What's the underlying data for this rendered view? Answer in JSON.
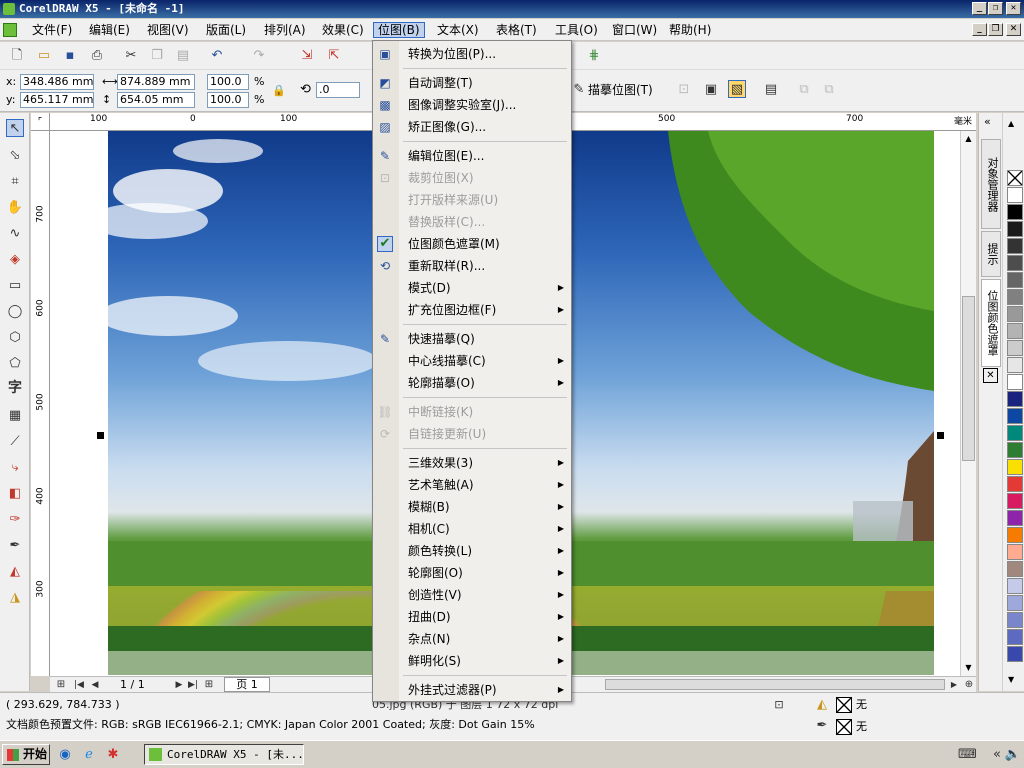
{
  "window": {
    "title": "CorelDRAW X5 - [未命名 -1]"
  },
  "menubar": [
    "文件(F)",
    "编辑(E)",
    "视图(V)",
    "版面(L)",
    "排列(A)",
    "效果(C)",
    "位图(B)",
    "文本(X)",
    "表格(T)",
    "工具(O)",
    "窗口(W)",
    "帮助(H)"
  ],
  "property_bar": {
    "x": "348.486 mm",
    "y": "465.117 mm",
    "width": "874.889 mm",
    "height": "654.05 mm",
    "scale_x": "100.0",
    "scale_y": "100.0",
    "pct": "%",
    "rotation": ".0",
    "trace_label": "描摹位图(T)"
  },
  "ruler_top": [
    "100",
    "0",
    "100",
    "500",
    "700",
    "毫米"
  ],
  "ruler_left": [
    "700",
    "600",
    "500",
    "400",
    "300"
  ],
  "bitmap_menu": [
    {
      "label": "转换为位图(P)...",
      "icon": "convert-bitmap-icon",
      "disabled": false,
      "submenu": false
    },
    {
      "sep": true
    },
    {
      "label": "自动调整(T)",
      "icon": "auto-adjust-icon",
      "disabled": false,
      "submenu": false
    },
    {
      "label": "图像调整实验室(J)...",
      "icon": "image-lab-icon",
      "disabled": false,
      "submenu": false
    },
    {
      "label": "矫正图像(G)...",
      "icon": "straighten-icon",
      "disabled": false,
      "submenu": false
    },
    {
      "sep": true
    },
    {
      "label": "编辑位图(E)...",
      "icon": "edit-bitmap-icon",
      "disabled": false,
      "submenu": false
    },
    {
      "label": "裁剪位图(X)",
      "icon": "crop-bitmap-icon",
      "disabled": true,
      "submenu": false
    },
    {
      "label": "打开版样来源(U)",
      "icon": "",
      "disabled": true,
      "submenu": false
    },
    {
      "label": "替换版样(C)...",
      "icon": "",
      "disabled": true,
      "submenu": false
    },
    {
      "label": "位图颜色遮罩(M)",
      "icon": "check-icon",
      "disabled": false,
      "submenu": false,
      "checked": true
    },
    {
      "label": "重新取样(R)...",
      "icon": "resample-icon",
      "disabled": false,
      "submenu": false
    },
    {
      "label": "模式(D)",
      "icon": "",
      "disabled": false,
      "submenu": true
    },
    {
      "label": "扩充位图边框(F)",
      "icon": "",
      "disabled": false,
      "submenu": true
    },
    {
      "sep": true
    },
    {
      "label": "快速描摹(Q)",
      "icon": "quick-trace-icon",
      "disabled": false,
      "submenu": false
    },
    {
      "label": "中心线描摹(C)",
      "icon": "",
      "disabled": false,
      "submenu": true
    },
    {
      "label": "轮廓描摹(O)",
      "icon": "",
      "disabled": false,
      "submenu": true
    },
    {
      "sep": true
    },
    {
      "label": "中断链接(K)",
      "icon": "break-link-icon",
      "disabled": true,
      "submenu": false
    },
    {
      "label": "自链接更新(U)",
      "icon": "update-link-icon",
      "disabled": true,
      "submenu": false
    },
    {
      "sep": true
    },
    {
      "label": "三维效果(3)",
      "icon": "",
      "disabled": false,
      "submenu": true
    },
    {
      "label": "艺术笔触(A)",
      "icon": "",
      "disabled": false,
      "submenu": true
    },
    {
      "label": "模糊(B)",
      "icon": "",
      "disabled": false,
      "submenu": true
    },
    {
      "label": "相机(C)",
      "icon": "",
      "disabled": false,
      "submenu": true
    },
    {
      "label": "颜色转换(L)",
      "icon": "",
      "disabled": false,
      "submenu": true
    },
    {
      "label": "轮廓图(O)",
      "icon": "",
      "disabled": false,
      "submenu": true
    },
    {
      "label": "创造性(V)",
      "icon": "",
      "disabled": false,
      "submenu": true
    },
    {
      "label": "扭曲(D)",
      "icon": "",
      "disabled": false,
      "submenu": true
    },
    {
      "label": "杂点(N)",
      "icon": "",
      "disabled": false,
      "submenu": true
    },
    {
      "label": "鲜明化(S)",
      "icon": "",
      "disabled": false,
      "submenu": true
    },
    {
      "sep": true
    },
    {
      "label": "外挂式过滤器(P)",
      "icon": "",
      "disabled": false,
      "submenu": true
    }
  ],
  "page_nav": {
    "count": "1 / 1",
    "tab": "页 1"
  },
  "docker_tabs": [
    "对象管理器",
    "提示",
    "位图颜色遮罩"
  ],
  "palette": [
    "#ffffff",
    "#000000",
    "#1a1a1a",
    "#333333",
    "#4d4d4d",
    "#666666",
    "#808080",
    "#999999",
    "#b3b3b3",
    "#cccccc",
    "#e6e6e6",
    "#ffffff",
    "#1a237e",
    "#0d47a1",
    "#00897b",
    "#2e7d32",
    "#f9e000",
    "#e53935",
    "#d81b60",
    "#8e24aa",
    "#f57c00",
    "#ffab91",
    "#a1887f",
    "#c5cae9",
    "#9fa8da",
    "#7986cb",
    "#5c6bc0",
    "#3949ab"
  ],
  "status": {
    "coords": "( 293.629, 784.733 )",
    "object_info": "05.jpg (RGB) 于 图层 1 72 x 72 dpi",
    "color_profile": "文档颜色预置文件: RGB: sRGB IEC61966-2.1; CMYK: Japan Color 2001 Coated; 灰度: Dot Gain 15%",
    "fill": "无",
    "outline": "无"
  },
  "taskbar": {
    "start": "开始",
    "task": "CorelDRAW X5 - [未..."
  }
}
